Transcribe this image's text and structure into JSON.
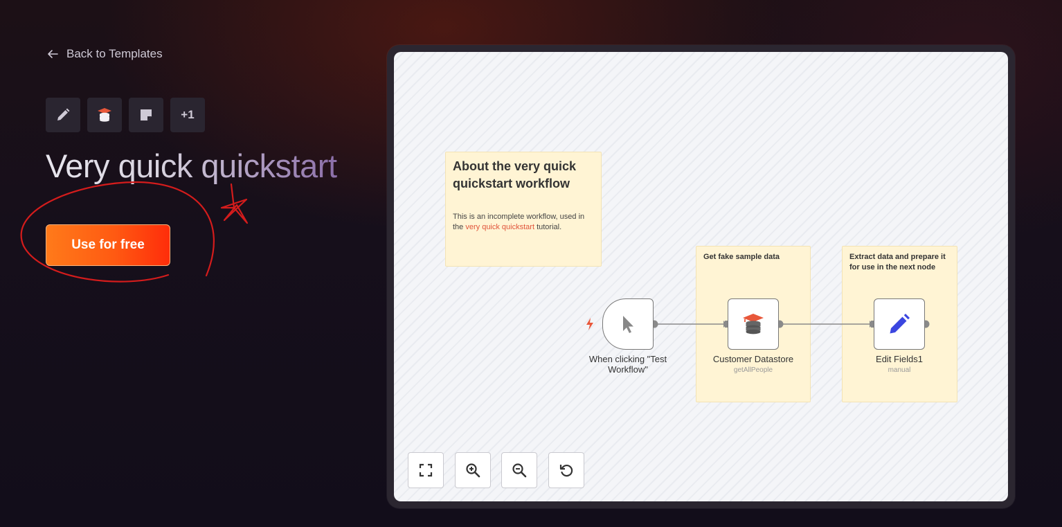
{
  "nav": {
    "back_label": "Back to Templates"
  },
  "tags": [
    {
      "icon": "pencil-icon"
    },
    {
      "icon": "database-icon"
    },
    {
      "icon": "sticky-note-icon"
    },
    {
      "label": "+1"
    }
  ],
  "hero": {
    "title": "Very quick quickstart",
    "cta_label": "Use for free"
  },
  "colors": {
    "cta_start": "#ff7a1a",
    "cta_end": "#ff2d0a",
    "annotation": "#d41c1c",
    "link": "#e0533a",
    "edit_icon": "#3b46e0"
  },
  "workflow": {
    "notes": {
      "about_title": "About the very quick quickstart workflow",
      "about_text_pre": "This is an incomplete workflow, used in the ",
      "about_link": "very quick quickstart",
      "about_text_post": " tutorial.",
      "sample_caption": "Get fake sample data",
      "extract_caption": "Extract data and prepare it for use in the next node"
    },
    "nodes": [
      {
        "label": "When clicking \"Test Workflow\"",
        "sub": "",
        "icon": "cursor-icon"
      },
      {
        "label": "Customer Datastore",
        "sub": "getAllPeople",
        "icon": "database-icon"
      },
      {
        "label": "Edit Fields1",
        "sub": "manual",
        "icon": "pencil-icon"
      }
    ]
  },
  "controls": [
    {
      "icon": "fit-view-icon"
    },
    {
      "icon": "zoom-in-icon"
    },
    {
      "icon": "zoom-out-icon"
    },
    {
      "icon": "reset-zoom-icon"
    }
  ]
}
